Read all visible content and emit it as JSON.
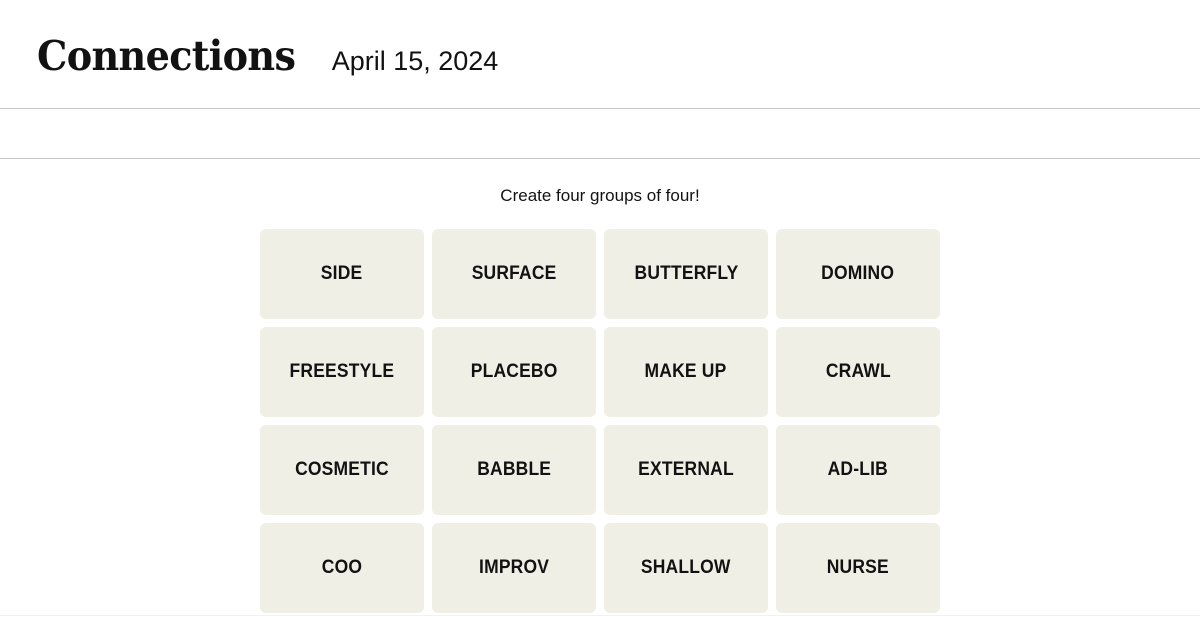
{
  "header": {
    "title": "Connections",
    "date": "April 15, 2024"
  },
  "toolbar": {
    "left_label": "",
    "right_label": ""
  },
  "board": {
    "instruction": "Create four groups of four!",
    "tiles": [
      {
        "label": "SIDE"
      },
      {
        "label": "SURFACE"
      },
      {
        "label": "BUTTERFLY"
      },
      {
        "label": "DOMINO"
      },
      {
        "label": "FREESTYLE"
      },
      {
        "label": "PLACEBO"
      },
      {
        "label": "MAKE UP"
      },
      {
        "label": "CRAWL"
      },
      {
        "label": "COSMETIC"
      },
      {
        "label": "BABBLE"
      },
      {
        "label": "EXTERNAL"
      },
      {
        "label": "AD-LIB"
      },
      {
        "label": "COO"
      },
      {
        "label": "IMPROV"
      },
      {
        "label": "SHALLOW"
      },
      {
        "label": "NURSE"
      }
    ]
  },
  "colors": {
    "page_background": "#ffffff",
    "tile_background": "#efefe6",
    "text": "#121212",
    "rule": "#c7c7c7",
    "footer_rule": "#f1f1f1"
  }
}
